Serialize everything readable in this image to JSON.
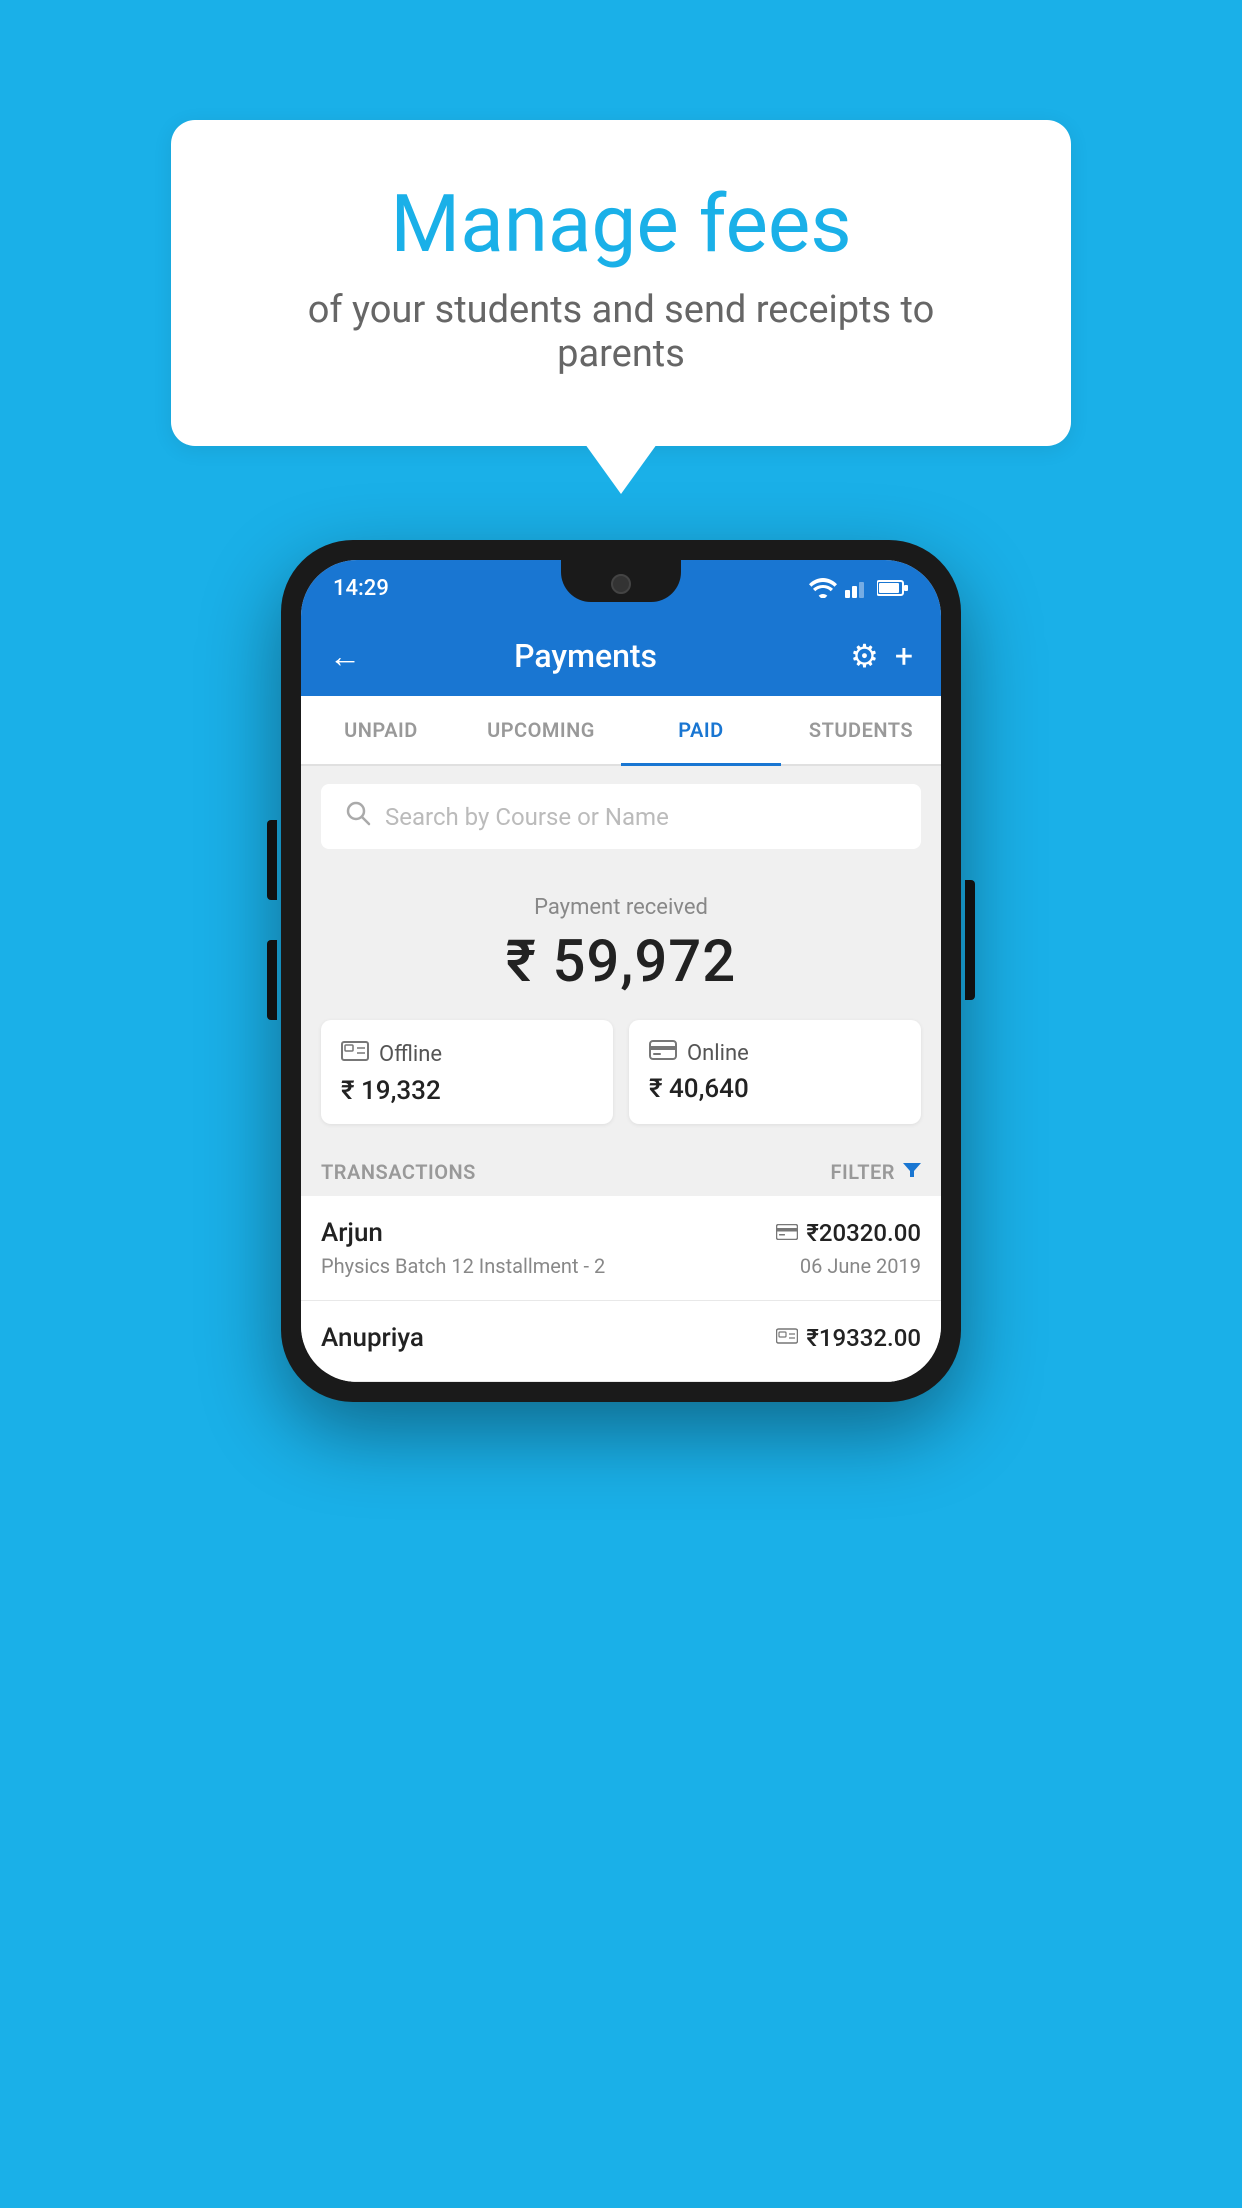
{
  "hero": {
    "bubble_title": "Manage fees",
    "bubble_subtitle": "of your students and send receipts to parents"
  },
  "status_bar": {
    "time": "14:29"
  },
  "app_bar": {
    "back_label": "←",
    "title": "Payments",
    "settings_label": "⚙",
    "add_label": "+"
  },
  "tabs": [
    {
      "id": "unpaid",
      "label": "UNPAID",
      "active": false
    },
    {
      "id": "upcoming",
      "label": "UPCOMING",
      "active": false
    },
    {
      "id": "paid",
      "label": "PAID",
      "active": true
    },
    {
      "id": "students",
      "label": "STUDENTS",
      "active": false
    }
  ],
  "search": {
    "placeholder": "Search by Course or Name"
  },
  "payment_summary": {
    "label": "Payment received",
    "total": "₹ 59,972",
    "offline_label": "Offline",
    "offline_amount": "₹ 19,332",
    "online_label": "Online",
    "online_amount": "₹ 40,640"
  },
  "transactions_section": {
    "label": "TRANSACTIONS",
    "filter_label": "FILTER"
  },
  "transactions": [
    {
      "name": "Arjun",
      "amount": "₹20320.00",
      "course": "Physics Batch 12 Installment - 2",
      "date": "06 June 2019",
      "payment_type": "card"
    },
    {
      "name": "Anupriya",
      "amount": "₹19332.00",
      "course": "",
      "date": "",
      "payment_type": "cash"
    }
  ],
  "colors": {
    "primary": "#1976d2",
    "accent": "#1ab0e8",
    "background": "#1ab0e8"
  }
}
